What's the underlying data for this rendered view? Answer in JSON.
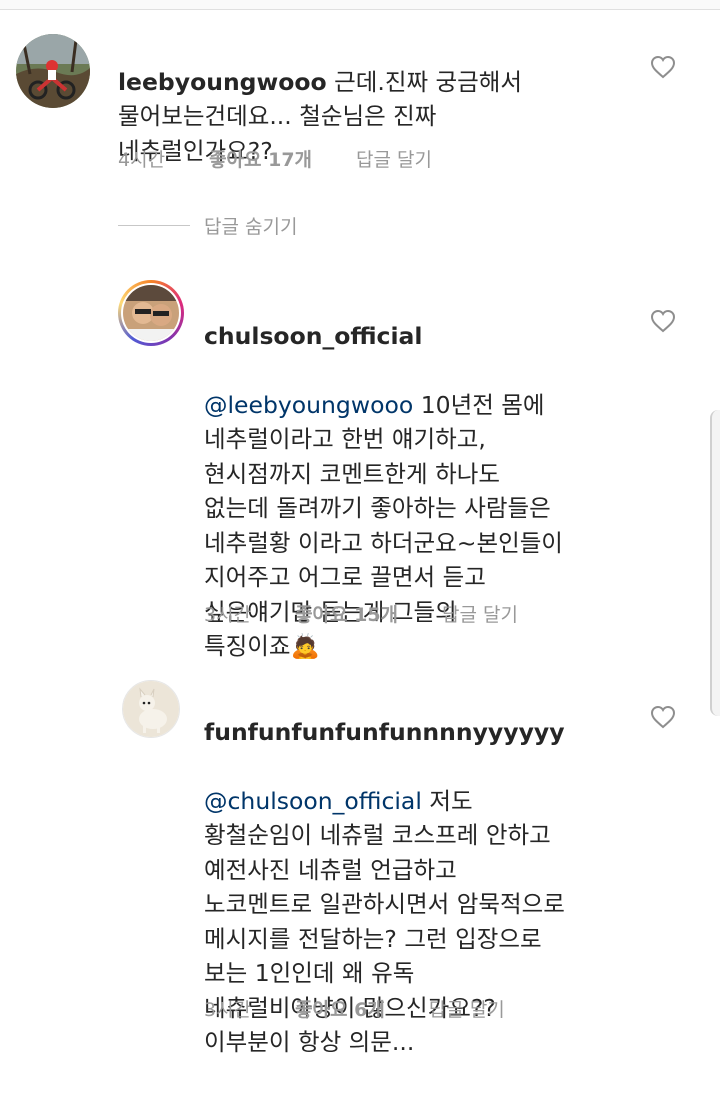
{
  "comments": [
    {
      "username": "leebyoungwooo",
      "text_first": " 근데.진짜 궁금해서",
      "text_rest": "물어보는건데요... 철순님은 진짜\n네추럴인가요??",
      "time": "4시간",
      "likes": "좋아요 17개",
      "reply": "답글 달기"
    },
    {
      "username": "chulsoon_official",
      "mention": "@leebyoungwooo",
      "text_first": " 10년전 몸에",
      "text_rest": "네추럴이라고 한번 얘기하고,\n현시점까지 코멘트한게 하나도\n없는데 돌려까기 좋아하는 사람들은\n네추럴황 이라고 하더군요~본인들이\n지어주고 어그로 끌면서 듣고\n싶은얘기만 듣는게 그들의\n특징이죠",
      "emoji": "🙇",
      "time": "3시간",
      "likes": "좋아요 15개",
      "reply": "답글 달기"
    },
    {
      "username": "funfunfunfunfunnnnyyyyyy",
      "mention": "@chulsoon_official",
      "text_first": " 저도",
      "text_rest": "황철순임이 네츄럴 코스프레 안하고\n예전사진 네츄럴 언급하고\n노코멘트로 일관하시면서 암묵적으로\n메시지를 전달하는? 그런 입장으로\n보는 1인인데 왜 유독\n네츄럴비아냥이 많으신가요??\n이부분이 항상 의문...",
      "time": "3시간",
      "likes": "좋아요 6개",
      "reply": "답글 달기"
    }
  ],
  "hide_replies": "답글 숨기기",
  "icons": {
    "like": "heart-outline-icon"
  },
  "colors": {
    "mention": "#003569",
    "meta": "#999999",
    "text": "#262626"
  }
}
